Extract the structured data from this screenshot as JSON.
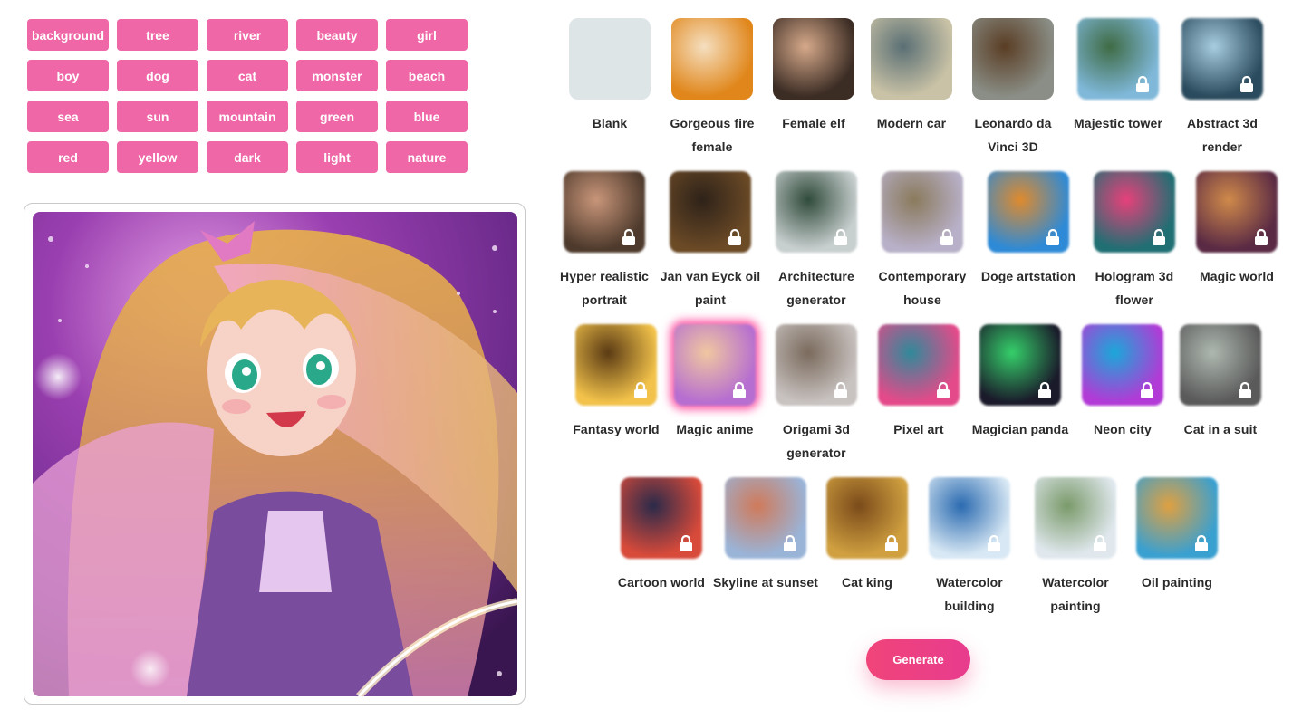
{
  "keywords": [
    "background",
    "tree",
    "river",
    "beauty",
    "girl",
    "boy",
    "dog",
    "cat",
    "monster",
    "beach",
    "sea",
    "sun",
    "mountain",
    "green",
    "blue",
    "red",
    "yellow",
    "dark",
    "light",
    "nature"
  ],
  "styles": [
    {
      "label": "Blank",
      "locked": false,
      "selected": false,
      "colors": [
        "#dde5e7",
        "#dde5e7"
      ]
    },
    {
      "label": "Gorgeous fire female",
      "locked": false,
      "selected": false,
      "colors": [
        "#e0861a",
        "#f5dfc0"
      ]
    },
    {
      "label": "Female elf",
      "locked": false,
      "selected": false,
      "colors": [
        "#3b2c24",
        "#d6a98a"
      ]
    },
    {
      "label": "Modern car",
      "locked": false,
      "selected": false,
      "colors": [
        "#c9c2a6",
        "#5a6f74"
      ]
    },
    {
      "label": "Leonardo da Vinci 3D",
      "locked": false,
      "selected": false,
      "colors": [
        "#8a8e86",
        "#5a3d24"
      ]
    },
    {
      "label": "Majestic tower",
      "locked": true,
      "selected": false,
      "colors": [
        "#7fb8d9",
        "#3f6b44"
      ]
    },
    {
      "label": "Abstract 3d render",
      "locked": true,
      "selected": false,
      "colors": [
        "#2a4b5d",
        "#a8cde0"
      ]
    },
    {
      "label": "Hyper realistic portrait",
      "locked": true,
      "selected": false,
      "colors": [
        "#4e3a2c",
        "#c9967a"
      ]
    },
    {
      "label": "Jan van Eyck oil paint",
      "locked": true,
      "selected": false,
      "colors": [
        "#6b4a26",
        "#2e2219"
      ]
    },
    {
      "label": "Architecture generator",
      "locked": true,
      "selected": false,
      "colors": [
        "#c8cfcf",
        "#2f4a3a"
      ]
    },
    {
      "label": "Contemporary house",
      "locked": true,
      "selected": false,
      "colors": [
        "#b8b0c8",
        "#8a7a5c"
      ]
    },
    {
      "label": "Doge artstation",
      "locked": true,
      "selected": false,
      "colors": [
        "#2e8ad6",
        "#e08a2c"
      ]
    },
    {
      "label": "Hologram 3d flower",
      "locked": true,
      "selected": false,
      "colors": [
        "#1f6f73",
        "#e8407a"
      ]
    },
    {
      "label": "Magic world",
      "locked": true,
      "selected": false,
      "colors": [
        "#5a2a44",
        "#d08a4a"
      ]
    },
    {
      "label": "Fantasy world",
      "locked": true,
      "selected": false,
      "colors": [
        "#f2c24a",
        "#5a3a14"
      ]
    },
    {
      "label": "Magic anime",
      "locked": true,
      "selected": true,
      "colors": [
        "#b66ed0",
        "#f0c7a0"
      ]
    },
    {
      "label": "Origami 3d generator",
      "locked": true,
      "selected": false,
      "colors": [
        "#c8c2c0",
        "#7a6a5c"
      ]
    },
    {
      "label": "Pixel art",
      "locked": true,
      "selected": false,
      "colors": [
        "#e44a8a",
        "#2f8a9a"
      ]
    },
    {
      "label": "Magician panda",
      "locked": true,
      "selected": false,
      "colors": [
        "#1a1a2a",
        "#35d06a"
      ]
    },
    {
      "label": "Neon city",
      "locked": true,
      "selected": false,
      "colors": [
        "#b23ad6",
        "#1aa8d8"
      ]
    },
    {
      "label": "Cat in a suit",
      "locked": true,
      "selected": false,
      "colors": [
        "#5a5a5a",
        "#aeb8b0"
      ]
    },
    {
      "label": "Cartoon world",
      "locked": true,
      "selected": false,
      "colors": [
        "#d84a3a",
        "#2a2a4a"
      ]
    },
    {
      "label": "Skyline at sunset",
      "locked": true,
      "selected": false,
      "colors": [
        "#9ab4d8",
        "#d07a5a"
      ]
    },
    {
      "label": "Cat king",
      "locked": true,
      "selected": false,
      "colors": [
        "#d0a040",
        "#7a4a1a"
      ]
    },
    {
      "label": "Watercolor building",
      "locked": true,
      "selected": false,
      "colors": [
        "#d8e8f4",
        "#2a6ab0"
      ]
    },
    {
      "label": "Watercolor painting",
      "locked": true,
      "selected": false,
      "colors": [
        "#e0e8ee",
        "#7a9a6a"
      ]
    },
    {
      "label": "Oil painting",
      "locked": true,
      "selected": false,
      "colors": [
        "#3aa0d0",
        "#e0a040"
      ]
    }
  ],
  "generate_label": "Generate",
  "colors": {
    "chip": "#ef67a7",
    "accent": "#f0447a",
    "preview_bg": "#7a2a8a"
  }
}
